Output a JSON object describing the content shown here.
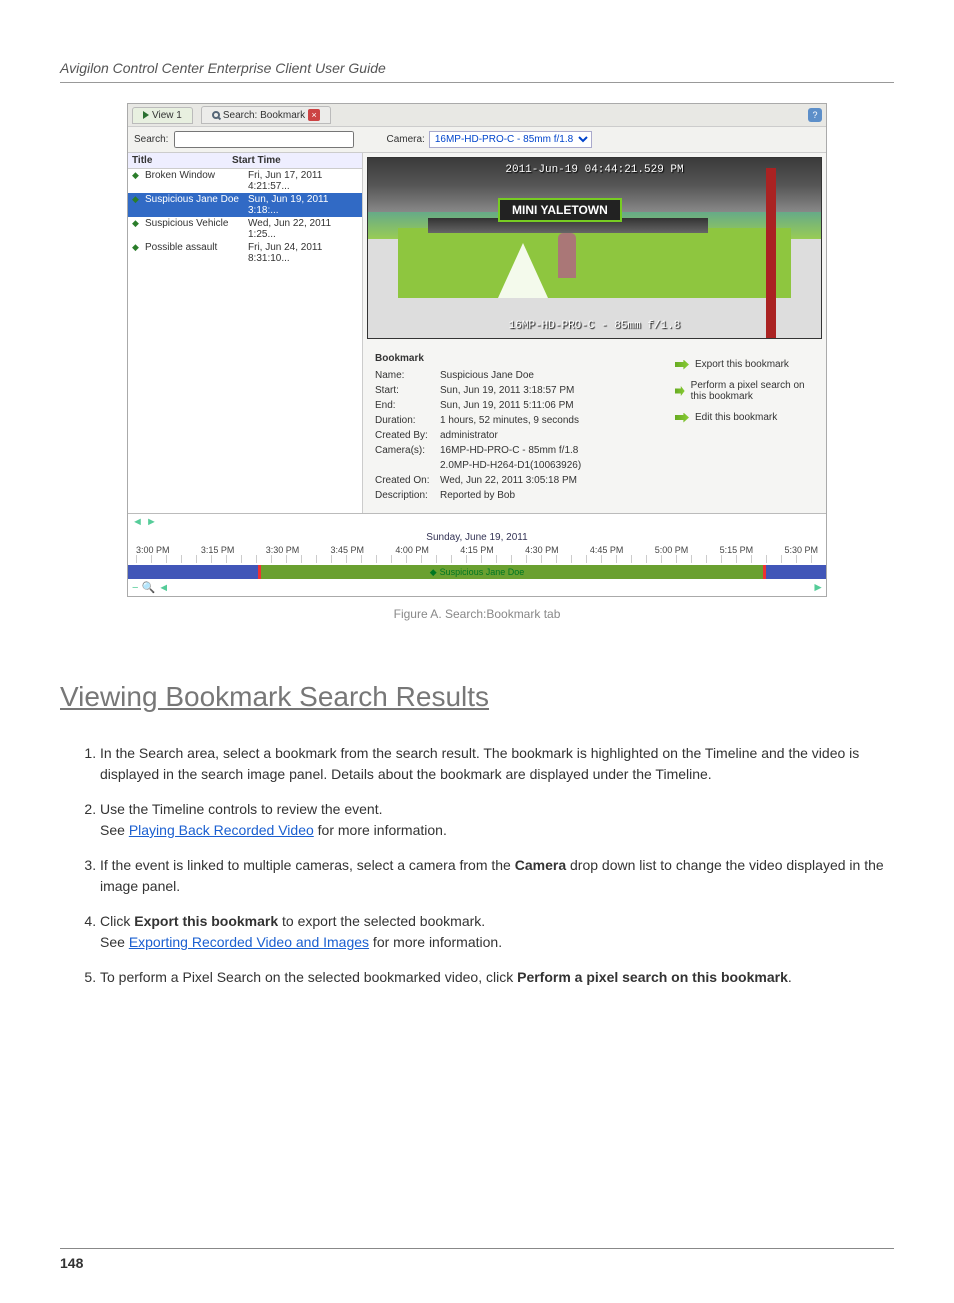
{
  "guide_title": "Avigilon Control Center Enterprise Client User Guide",
  "screenshot": {
    "tabs": {
      "view": "View 1",
      "search": "Search: Bookmark"
    },
    "search_label": "Search:",
    "search_value": "",
    "camera_label": "Camera:",
    "camera_value": "16MP-HD-PRO-C - 85mm f/1.8",
    "list_headers": {
      "title": "Title",
      "time": "Start Time"
    },
    "list": [
      {
        "title": "Broken Window",
        "time": "Fri, Jun 17, 2011 4:21:57..."
      },
      {
        "title": "Suspicious Jane Doe",
        "time": "Sun, Jun 19, 2011 3:18:..."
      },
      {
        "title": "Suspicious Vehicle",
        "time": "Wed, Jun 22, 2011 1:25..."
      },
      {
        "title": "Possible assault",
        "time": "Fri, Jun 24, 2011 8:31:10..."
      }
    ],
    "video": {
      "timestamp": "2011-Jun-19 04:44:21.529 PM",
      "store_sign": "MINI YALETOWN",
      "camera_overlay": "16MP-HD-PRO-C - 85mm f/1.8"
    },
    "details": {
      "heading": "Bookmark",
      "name_l": "Name:",
      "name": "Suspicious Jane Doe",
      "start_l": "Start:",
      "start": "Sun, Jun 19, 2011 3:18:57 PM",
      "end_l": "End:",
      "end": "Sun, Jun 19, 2011 5:11:06 PM",
      "duration_l": "Duration:",
      "duration": "1 hours, 52 minutes, 9 seconds",
      "createdby_l": "Created By:",
      "createdby": "administrator",
      "cameras_l": "Camera(s):",
      "cameras1": "16MP-HD-PRO-C - 85mm f/1.8",
      "cameras2": "2.0MP-HD-H264-D1(10063926)",
      "createdon_l": "Created On:",
      "createdon": "Wed, Jun 22, 2011 3:05:18 PM",
      "desc_l": "Description:",
      "desc": "Reported by Bob"
    },
    "actions": {
      "export": "Export this bookmark",
      "pixel": "Perform a pixel search on this bookmark",
      "edit": "Edit this bookmark"
    },
    "timeline": {
      "date": "Sunday, June 19, 2011",
      "times": [
        "3:00 PM",
        "3:15 PM",
        "3:30 PM",
        "3:45 PM",
        "4:00 PM",
        "4:15 PM",
        "4:30 PM",
        "4:45 PM",
        "5:00 PM",
        "5:15 PM",
        "5:30 PM"
      ],
      "bookmark_label": "Suspicious Jane Doe"
    },
    "figure_caption": "Figure A. Search:Bookmark tab"
  },
  "section_heading": "Viewing Bookmark Search Results",
  "body": {
    "step1": "In the Search area, select a bookmark from the search result. The bookmark is highlighted on the Timeline and the video is displayed in the search image panel. Details about the bookmark are displayed under the Timeline.",
    "step2a": "Use the Timeline controls to review the event.",
    "step2b": "See ",
    "step2b_link": "Playing Back Recorded Video",
    "step2c": " for more information.",
    "step3a": "If the event is linked to multiple cameras, select a camera from the ",
    "step3b": " drop down list to change the video displayed in the image panel.",
    "camera_bold": "Camera",
    "step4a": "Click ",
    "step4b": " to export the selected bookmark.",
    "export_bold": "Export this bookmark",
    "step5a": "See ",
    "step5a_link": "Exporting Recorded Video and Images",
    "step5b": " for more information.",
    "step6a": "To perform a Pixel Search on the selected bookmarked video, click ",
    "step6b": ".",
    "pixel_bold": "Perform a pixel search on this bookmark"
  },
  "page_num": "148"
}
